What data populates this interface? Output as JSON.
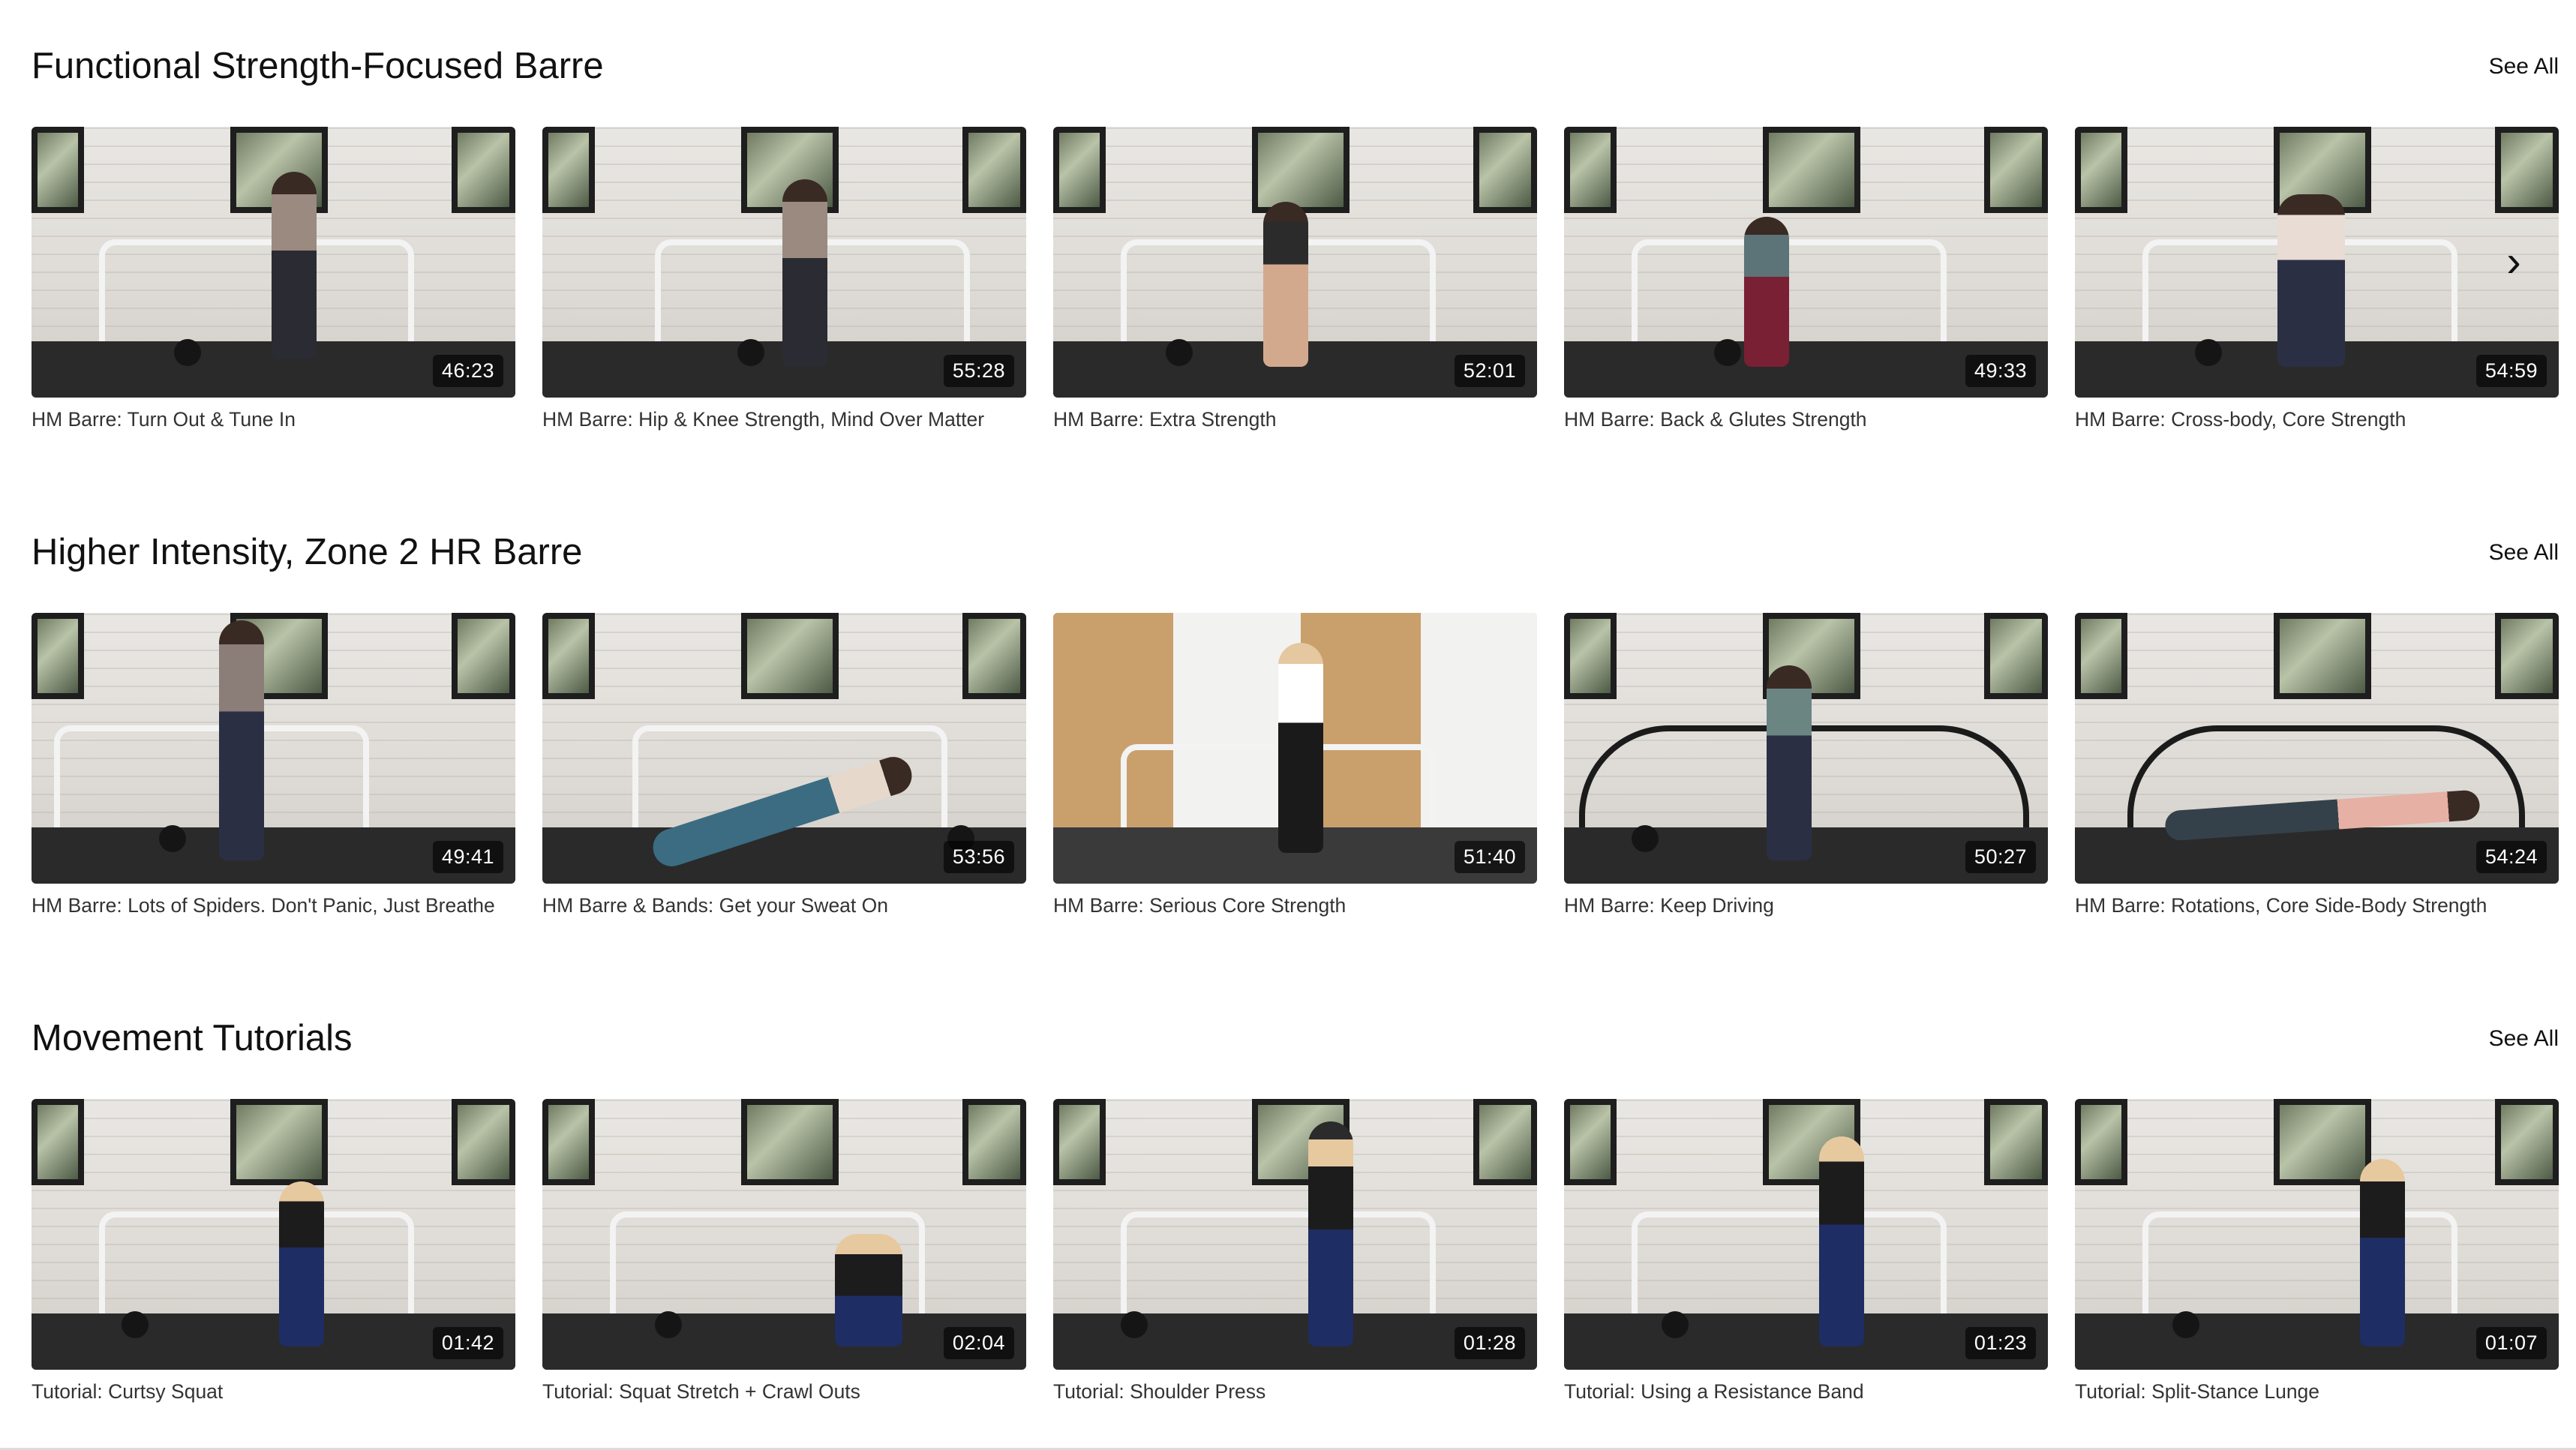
{
  "sections": [
    {
      "title": "Functional Strength-Focused Barre",
      "see_all": "See All",
      "videos": [
        {
          "title": "HM Barre: Turn Out & Tune In",
          "duration": "46:23"
        },
        {
          "title": "HM Barre: Hip & Knee Strength, Mind Over Matter",
          "duration": "55:28"
        },
        {
          "title": "HM Barre: Extra Strength",
          "duration": "52:01"
        },
        {
          "title": "HM Barre: Back & Glutes Strength",
          "duration": "49:33"
        },
        {
          "title": "HM Barre: Cross-body, Core Strength",
          "duration": "54:59"
        }
      ]
    },
    {
      "title": "Higher Intensity, Zone 2 HR Barre",
      "see_all": "See All",
      "videos": [
        {
          "title": "HM Barre: Lots of Spiders. Don't Panic, Just Breathe",
          "duration": "49:41"
        },
        {
          "title": "HM Barre & Bands: Get your Sweat On",
          "duration": "53:56"
        },
        {
          "title": "HM Barre: Serious Core Strength",
          "duration": "51:40"
        },
        {
          "title": "HM Barre: Keep Driving",
          "duration": "50:27"
        },
        {
          "title": "HM Barre: Rotations, Core Side-Body Strength",
          "duration": "54:24"
        }
      ]
    },
    {
      "title": "Movement Tutorials",
      "see_all": "See All",
      "videos": [
        {
          "title": "Tutorial: Curtsy Squat",
          "duration": "01:42"
        },
        {
          "title": "Tutorial: Squat Stretch + Crawl Outs",
          "duration": "02:04"
        },
        {
          "title": "Tutorial: Shoulder Press",
          "duration": "01:28"
        },
        {
          "title": "Tutorial: Using a Resistance Band",
          "duration": "01:23"
        },
        {
          "title": "Tutorial: Split-Stance Lunge",
          "duration": "01:07"
        }
      ]
    }
  ],
  "carousel": {
    "next_icon": "chevron-right-icon",
    "next_glyph": "›"
  }
}
